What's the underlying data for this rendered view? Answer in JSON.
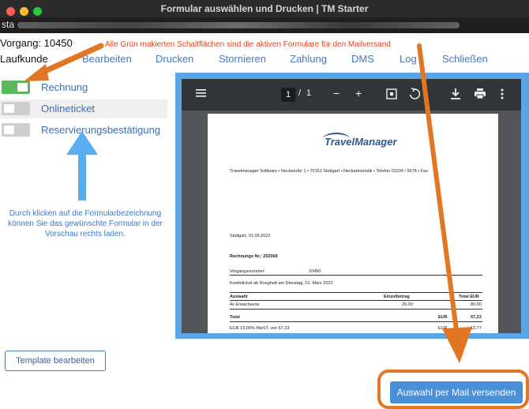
{
  "window": {
    "title": "Formular auswählen und Drucken | TM Starter"
  },
  "url": {
    "prefix": "sta"
  },
  "vorgang": {
    "label": "Vorgang: 10450"
  },
  "hint_text": "Alle Grün makierten Schaltflächen sind die aktiven Formulare für den Mailversand",
  "customer": "Laufkunde",
  "menu": [
    "Bearbeiten",
    "Drucken",
    "Stornieren",
    "Zahlung",
    "DMS",
    "Log",
    "Schließen"
  ],
  "forms": [
    {
      "label": "Rechnung",
      "active": true
    },
    {
      "label": "Onlineticket",
      "active": false
    },
    {
      "label": "Reservierungsbestätigung",
      "active": false
    }
  ],
  "instruction": "Durch klicken auf die Formularbezeichnung können Sie das gewünschte Formular in der Vorschau rechts laden.",
  "template_button": "Template bearbeiten",
  "mail_button": "Auswahl per Mail versenden",
  "pdf_toolbar": {
    "menu_icon": "hamburger-menu-icon",
    "page_current": "1",
    "page_separator": "/",
    "page_total": "1",
    "zoom_out": "−",
    "zoom_in": "+",
    "icons": [
      "fit-page-icon",
      "rotate-icon",
      "download-icon",
      "print-icon",
      "more-options-icon"
    ]
  },
  "pdf": {
    "logo": "TravelManager",
    "address": "Travelmanager Software  •  Neckarufer 1  •  70151 Stuttgart  •  Neckartouristik  •  Telefon 01234 / 5678  •  Fax",
    "date": "Stuttgart, 01.03.2022",
    "invoice_no": "Rechnungs Nr.: 202068",
    "vorgangsnummer_label": "Vorgangsnummer:",
    "vorgangsnummer_value": "10450",
    "description": "Kombiticket ab Runghott am Dienstag, 01. März 2022",
    "table_headers": [
      "Auswahl",
      "Einzelbetrag",
      "Total EUR"
    ],
    "rows": [
      {
        "item": "4x Erwachsene",
        "single": "20,00",
        "total": "80,00"
      }
    ],
    "total_label": "Total",
    "total_currency": "EUR",
    "total_value": "67,23",
    "tax_label": "EUR 19,00% MwST. von 67,23",
    "tax_currency": "EUR",
    "tax_value": "12,77"
  },
  "colors": {
    "toggle_on": "#5cb85c",
    "toggle_off": "#cfcfcf",
    "hint_red": "#e0451f",
    "arrow_orange": "#e37623",
    "arrow_blue": "#5aaef0",
    "preview_border": "#58a6e8"
  }
}
